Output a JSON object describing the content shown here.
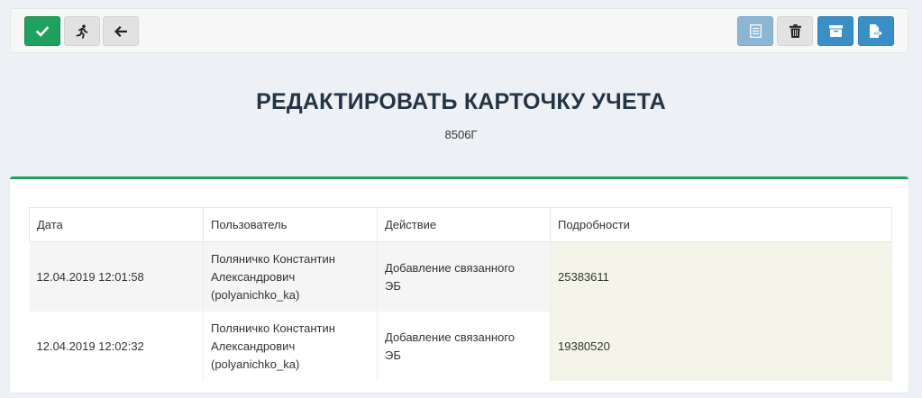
{
  "toolbar": {
    "left_buttons": [
      {
        "icon": "checkmark-icon",
        "color": "#1fa05c"
      },
      {
        "icon": "running-man-icon"
      },
      {
        "icon": "arrow-left-icon"
      }
    ],
    "right_buttons": [
      {
        "icon": "list-icon",
        "color": "#8bb6d6"
      },
      {
        "icon": "trash-icon"
      },
      {
        "icon": "archive-icon",
        "color": "#3a8fc6"
      },
      {
        "icon": "export-file-icon",
        "color": "#3a8fc6"
      }
    ]
  },
  "header": {
    "title": "РЕДАКТИРОВАТЬ КАРТОЧКУ УЧЕТА",
    "subtitle": "8506Г"
  },
  "table": {
    "columns": [
      "Дата",
      "Пользователь",
      "Действие",
      "Подробности"
    ],
    "rows": [
      {
        "date": "12.04.2019 12:01:58",
        "user_line1": "Поляничко Константин",
        "user_line2": "Александрович",
        "user_line3": "(polyanichko_ka)",
        "action_line1": "Добавление связанного",
        "action_line2": "ЭБ",
        "details": "25383611"
      },
      {
        "date": "12.04.2019 12:02:32",
        "user_line1": "Поляничко Константин",
        "user_line2": "Александрович",
        "user_line3": "(polyanichko_ka)",
        "action_line1": "Добавление связанного",
        "action_line2": "ЭБ",
        "details": "19380520"
      }
    ]
  },
  "colors": {
    "accent_green": "#1fa05c",
    "accent_blue": "#3a8fc6",
    "title": "#233447",
    "details_bg": "#f4f5e8"
  }
}
